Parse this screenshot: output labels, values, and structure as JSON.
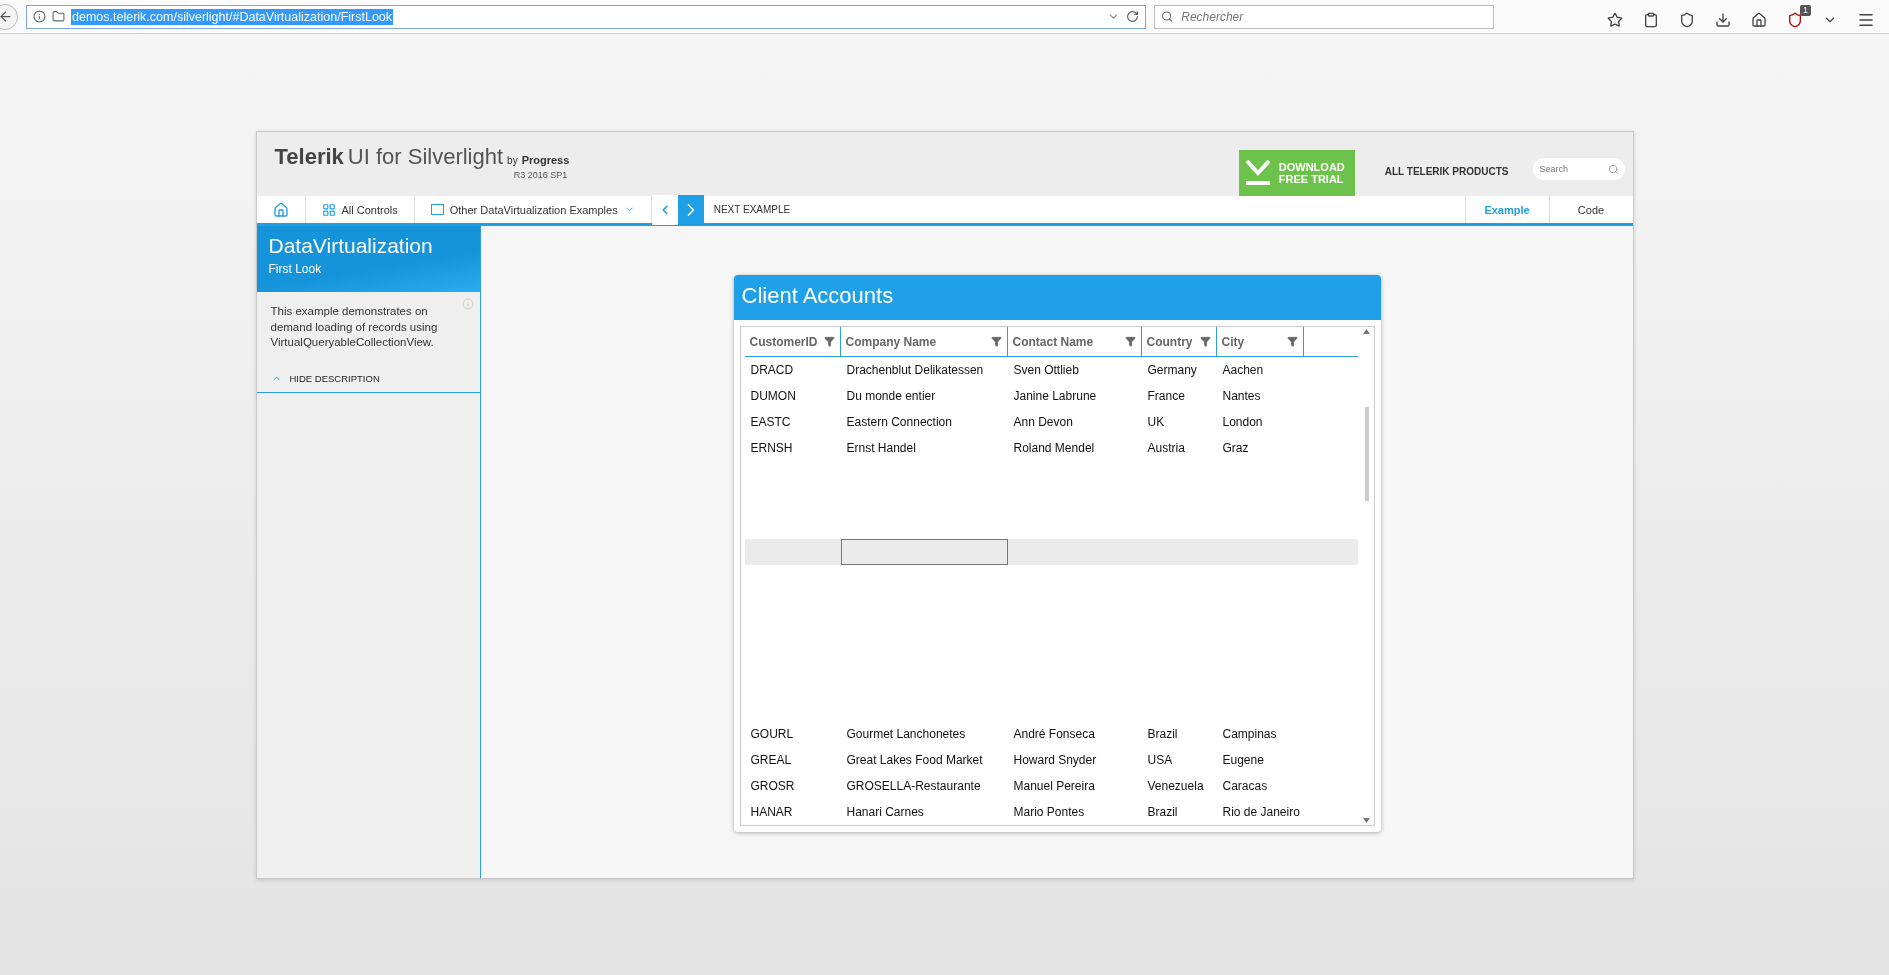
{
  "browser": {
    "url": "demos.telerik.com/silverlight/#DataVirtualization/FirstLook",
    "url_selected": true,
    "search_placeholder": "Rechercher",
    "badge": "1"
  },
  "header": {
    "brand": "Telerik",
    "product": "UI for Silverlight",
    "by": "by",
    "company": "Progress",
    "version": "R3 2016 SP1",
    "download": "DOWNLOAD FREE TRIAL",
    "all_products": "ALL TELERIK PRODUCTS",
    "search_placeholder": "Search"
  },
  "nav": {
    "all_controls": "All Controls",
    "other_examples": "Other DataVirtualization Examples",
    "next": "NEXT EXAMPLE",
    "tabs": [
      {
        "label": "Example",
        "selected": true
      },
      {
        "label": "Code",
        "selected": false
      }
    ]
  },
  "sidebar": {
    "title": "DataVirtualization",
    "subtitle": "First Look",
    "description": "This example demonstrates on demand loading of records using VirtualQueryableCollectionView.",
    "toggle": "HIDE DESCRIPTION",
    "expanded": true
  },
  "grid": {
    "title": "Client Accounts",
    "columns": [
      "CustomerID",
      "Company Name",
      "Contact Name",
      "Country",
      "City"
    ],
    "rows": [
      {
        "kind": "data",
        "selected": false,
        "cells": [
          "DRACD",
          "Drachenblut Delikatessen",
          "Sven Ottlieb",
          "Germany",
          "Aachen"
        ]
      },
      {
        "kind": "data",
        "selected": false,
        "cells": [
          "DUMON",
          "Du monde entier",
          "Janine Labrune",
          "France",
          "Nantes"
        ]
      },
      {
        "kind": "data",
        "selected": false,
        "cells": [
          "EASTC",
          "Eastern Connection",
          "Ann Devon",
          "UK",
          "London"
        ]
      },
      {
        "kind": "data",
        "selected": false,
        "cells": [
          "ERNSH",
          "Ernst Handel",
          "Roland Mendel",
          "Austria",
          "Graz"
        ]
      },
      {
        "kind": "pending",
        "selected": false
      },
      {
        "kind": "pending",
        "selected": false
      },
      {
        "kind": "pending",
        "selected": false
      },
      {
        "kind": "pending",
        "selected": true,
        "focus": [
          false,
          true,
          false,
          false,
          false
        ]
      },
      {
        "kind": "pending",
        "selected": false
      },
      {
        "kind": "pending",
        "selected": false
      },
      {
        "kind": "pending",
        "selected": false
      },
      {
        "kind": "pending",
        "selected": false
      },
      {
        "kind": "pending",
        "selected": false
      },
      {
        "kind": "pending",
        "selected": false
      },
      {
        "kind": "data",
        "selected": false,
        "cells": [
          "GOURL",
          "Gourmet Lanchonetes",
          "André Fonseca",
          "Brazil",
          "Campinas"
        ]
      },
      {
        "kind": "data",
        "selected": false,
        "cells": [
          "GREAL",
          "Great Lakes Food Market",
          "Howard Snyder",
          "USA",
          "Eugene"
        ]
      },
      {
        "kind": "data",
        "selected": false,
        "cells": [
          "GROSR",
          "GROSELLA-Restaurante",
          "Manuel Pereira",
          "Venezuela",
          "Caracas"
        ]
      },
      {
        "kind": "data",
        "selected": false,
        "cells": [
          "HANAR",
          "Hanari Carnes",
          "Mario Pontes",
          "Brazil",
          "Rio de Janeiro"
        ]
      }
    ]
  }
}
